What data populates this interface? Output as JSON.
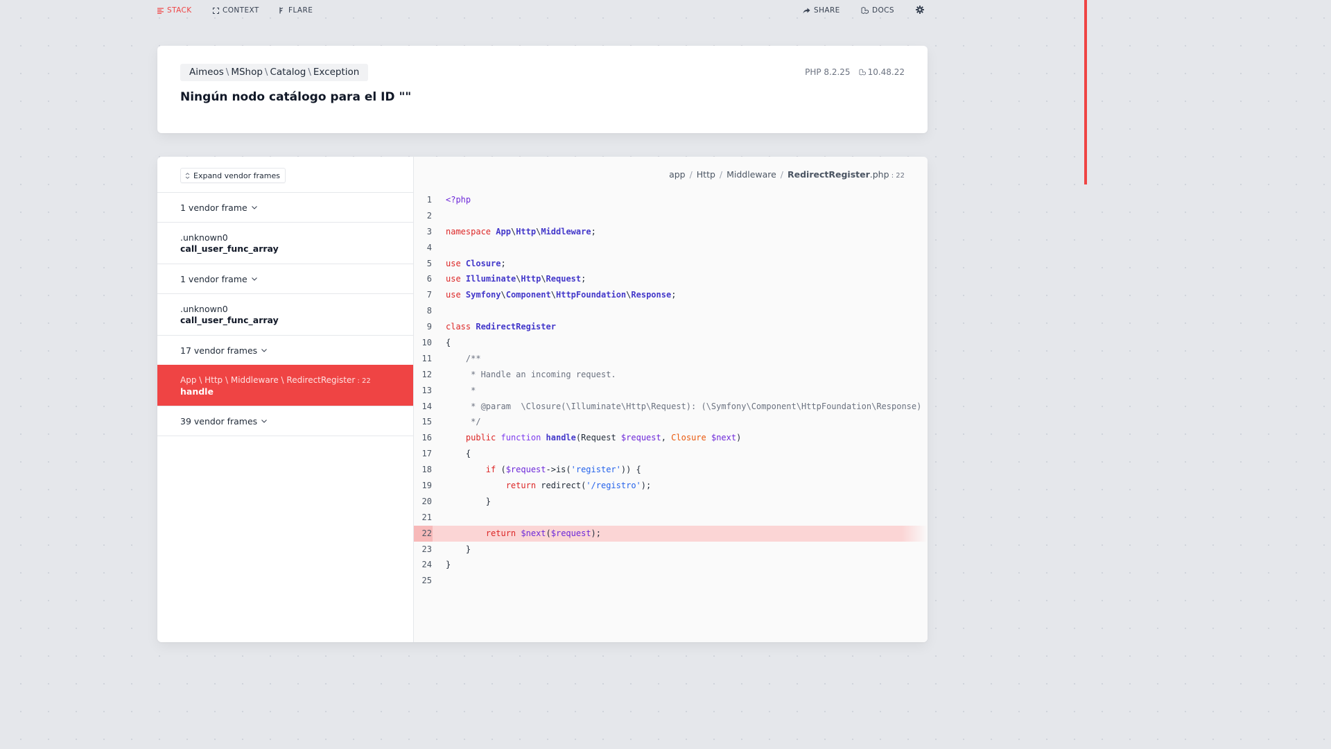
{
  "nav": {
    "stack": "STACK",
    "context": "CONTEXT",
    "flare": "FLARE",
    "share": "SHARE",
    "docs": "DOCS"
  },
  "header": {
    "exception_parts": [
      "Aimeos",
      "MShop",
      "Catalog",
      "Exception"
    ],
    "message": "Ningún nodo catálogo para el ID \"\"",
    "php_version": "PHP 8.2.25",
    "laravel_version": "10.48.22"
  },
  "frames": {
    "expand_label": "Expand vendor frames",
    "items": [
      {
        "type": "vendor",
        "label": "1 vendor frame"
      },
      {
        "type": "frame",
        "file": ".unknown0",
        "fn": "call_user_func_array"
      },
      {
        "type": "vendor",
        "label": "1 vendor frame"
      },
      {
        "type": "frame",
        "file": ".unknown0",
        "fn": "call_user_func_array"
      },
      {
        "type": "vendor",
        "label": "17 vendor frames"
      },
      {
        "type": "selected",
        "file_parts": [
          "App",
          "Http",
          "Middleware",
          "RedirectRegister"
        ],
        "line": "22",
        "fn": "handle"
      },
      {
        "type": "vendor",
        "label": "39 vendor frames"
      }
    ]
  },
  "code": {
    "path_parts": [
      "app",
      "Http",
      "Middleware"
    ],
    "file_name": "RedirectRegister",
    "file_ext": ".php",
    "line": "22",
    "highlight_line": 22,
    "line_numbers": [
      "1",
      "2",
      "3",
      "4",
      "5",
      "6",
      "7",
      "8",
      "9",
      "10",
      "11",
      "12",
      "13",
      "14",
      "15",
      "16",
      "17",
      "18",
      "19",
      "20",
      "21",
      "22",
      "23",
      "24",
      "25"
    ],
    "lines": [
      "<?php",
      "",
      "namespace App\\Http\\Middleware;",
      "",
      "use Closure;",
      "use Illuminate\\Http\\Request;",
      "use Symfony\\Component\\HttpFoundation\\Response;",
      "",
      "class RedirectRegister",
      "{",
      "    /**",
      "     * Handle an incoming request.",
      "     *",
      "     * @param  \\Closure(\\Illuminate\\Http\\Request): (\\Symfony\\Component\\HttpFoundation\\Response)  $next",
      "     */",
      "    public function handle(Request $request, Closure $next)",
      "    {",
      "        if ($request->is('register')) {",
      "            return redirect('/registro');",
      "        }",
      "",
      "        return $next($request);",
      "    }",
      "}",
      ""
    ]
  }
}
